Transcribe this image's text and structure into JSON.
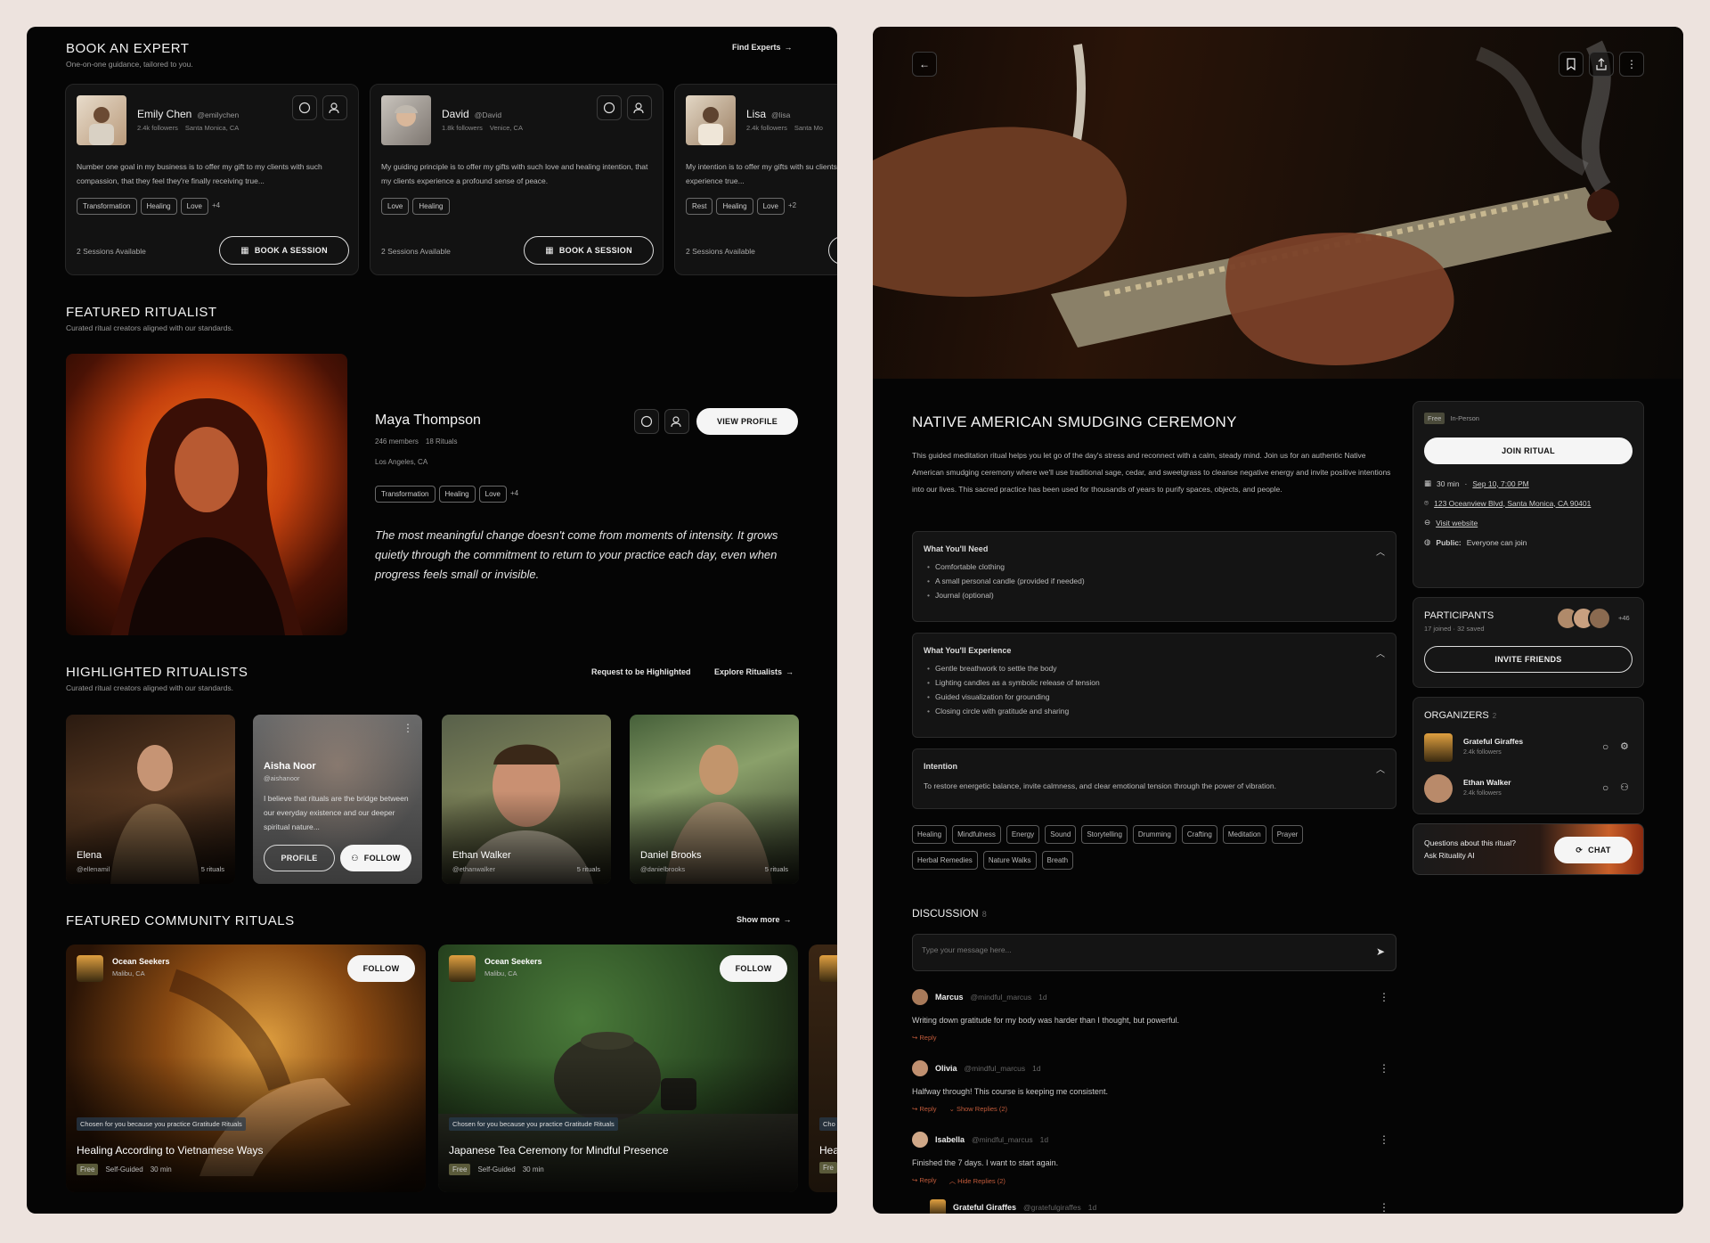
{
  "left": {
    "book_expert": {
      "title": "BOOK AN EXPERT",
      "subtitle": "One-on-one guidance, tailored to you.",
      "link": "Find Experts",
      "experts": [
        {
          "name": "Emily Chen",
          "handle": "@emilychen",
          "followers": "2.4k followers",
          "location": "Santa Monica, CA",
          "bio": "Number one goal in my business is to offer my gift to my clients with such compassion, that they feel they're finally receiving true...",
          "tags": [
            "Transformation",
            "Healing",
            "Love"
          ],
          "more": "+4",
          "sessions": "2 Sessions Available",
          "button": "BOOK A SESSION"
        },
        {
          "name": "David",
          "handle": "@David",
          "followers": "1.8k followers",
          "location": "Venice, CA",
          "bio": "My guiding principle is to offer my gifts with such love and healing intention, that my clients experience a profound sense of peace.",
          "tags": [
            "Love",
            "Healing"
          ],
          "more": "",
          "sessions": "2 Sessions Available",
          "button": "BOOK A SESSION"
        },
        {
          "name": "Lisa",
          "handle": "@lisa",
          "followers": "2.4k followers",
          "location": "Santa Mo",
          "bio": "My intention is to offer my gifts with su clients experience true...",
          "tags": [
            "Rest",
            "Healing",
            "Love"
          ],
          "more": "+2",
          "sessions": "2 Sessions Available",
          "button": ""
        }
      ]
    },
    "featured": {
      "title": "FEATURED RITUALIST",
      "subtitle": "Curated ritual creators aligned with our standards.",
      "name": "Maya Thompson",
      "members": "246 members",
      "rituals": "18 Rituals",
      "location": "Los Angeles, CA",
      "tags": [
        "Transformation",
        "Healing",
        "Love"
      ],
      "more": "+4",
      "button": "VIEW PROFILE",
      "quote": "The most meaningful change doesn't come from moments of intensity. It grows quietly through the commitment to return to your practice each day, even when progress feels small or invisible."
    },
    "highlighted": {
      "title": "HIGHLIGHTED RITUALISTS",
      "subtitle": "Curated ritual creators aligned with our standards.",
      "request_link": "Request to be Highlighted",
      "explore_link": "Explore Ritualists",
      "people": [
        {
          "name": "Elena",
          "handle": "@ellenamil",
          "rituals": "5 rituals"
        },
        {
          "name": "Aisha Noor",
          "handle": "@aishanoor",
          "bio": "I believe that rituals are the bridge between our everyday existence and our deeper spiritual nature...",
          "profile_btn": "PROFILE",
          "follow_btn": "FOLLOW"
        },
        {
          "name": "Ethan Walker",
          "handle": "@ethanwalker",
          "rituals": "5 rituals"
        },
        {
          "name": "Daniel Brooks",
          "handle": "@danielbrooks",
          "rituals": "5 rituals"
        }
      ]
    },
    "community": {
      "title": "FEATURED COMMUNITY RITUALS",
      "link": "Show more",
      "items": [
        {
          "org": "Ocean Seekers",
          "loc": "Malibu, CA",
          "follow": "FOLLOW",
          "reason": "Chosen for you because you practice Gratitude Rituals",
          "title": "Healing According to Vietnamese Ways",
          "price": "Free",
          "mode": "Self-Guided",
          "duration": "30 min"
        },
        {
          "org": "Ocean Seekers",
          "loc": "Malibu, CA",
          "follow": "FOLLOW",
          "reason": "Chosen for you because you practice Gratitude Rituals",
          "title": "Japanese Tea Ceremony for Mindful Presence",
          "price": "Free",
          "mode": "Self-Guided",
          "duration": "30 min"
        },
        {
          "reason": "Cho",
          "title": "Hea",
          "price": "Fre"
        }
      ]
    }
  },
  "right": {
    "title": "NATIVE AMERICAN SMUDGING CEREMONY",
    "description": "This guided meditation ritual helps you let go of the day's stress and reconnect with a calm, steady mind. Join us for an authentic Native American smudging ceremony where we'll use traditional sage, cedar, and sweetgrass to cleanse negative energy and invite positive intentions into our lives. This sacred practice has been used for thousands of years to purify spaces, objects, and people.",
    "sections": [
      {
        "title": "What You'll Need",
        "items": [
          "Comfortable clothing",
          "A small personal candle (provided if needed)",
          "Journal (optional)"
        ]
      },
      {
        "title": "What You'll Experience",
        "items": [
          "Gentle breathwork to settle the body",
          "Lighting candles as a symbolic release of tension",
          "Guided visualization for grounding",
          "Closing circle with gratitude and sharing"
        ]
      },
      {
        "title": "Intention",
        "text": "To restore energetic balance, invite calmness, and clear emotional tension through the power of vibration."
      }
    ],
    "tags": [
      "Healing",
      "Mindfulness",
      "Energy",
      "Sound",
      "Storytelling",
      "Drumming",
      "Crafting",
      "Meditation",
      "Prayer",
      "Herbal Remedies",
      "Nature Walks",
      "Breath"
    ],
    "discussion": {
      "title": "DISCUSSION",
      "count": "8",
      "placeholder": "Type your message here...",
      "comments": [
        {
          "name": "Marcus",
          "handle": "@mindful_marcus",
          "time": "1d",
          "text": "Writing down gratitude for my body was harder than I thought, but powerful.",
          "reply": "Reply",
          "extra": ""
        },
        {
          "name": "Olivia",
          "handle": "@mindful_marcus",
          "time": "1d",
          "text": "Halfway through! This course is keeping me consistent.",
          "reply": "Reply",
          "extra": "Show Replies (2)"
        },
        {
          "name": "Isabella",
          "handle": "@mindful_marcus",
          "time": "1d",
          "text": "Finished the 7 days. I want to start again.",
          "reply": "Reply",
          "extra": "Hide Replies (2)"
        },
        {
          "name": "Grateful Giraffes",
          "handle": "@gratefulgiraffes",
          "time": "1d"
        }
      ]
    },
    "info": {
      "price": "Free",
      "mode": "In-Person",
      "join": "JOIN RITUAL",
      "duration": "30 min",
      "date": "Sep 10, 7:00 PM",
      "address": "123 Oceanview Blvd, Santa Monica, CA 90401",
      "website": "Visit website",
      "visibility_label": "Public:",
      "visibility": "Everyone can join"
    },
    "participants": {
      "title": "PARTICIPANTS",
      "stats": "17 joined · 32 saved",
      "more": "+46",
      "button": "INVITE FRIENDS"
    },
    "organizers": {
      "title": "ORGANIZERS",
      "count": "2",
      "list": [
        {
          "name": "Grateful Giraffes",
          "followers": "2.4k followers"
        },
        {
          "name": "Ethan Walker",
          "followers": "2.4k followers"
        }
      ]
    },
    "ai": {
      "question": "Questions about this ritual?",
      "cta": "Ask Rituality AI",
      "button": "CHAT"
    }
  }
}
